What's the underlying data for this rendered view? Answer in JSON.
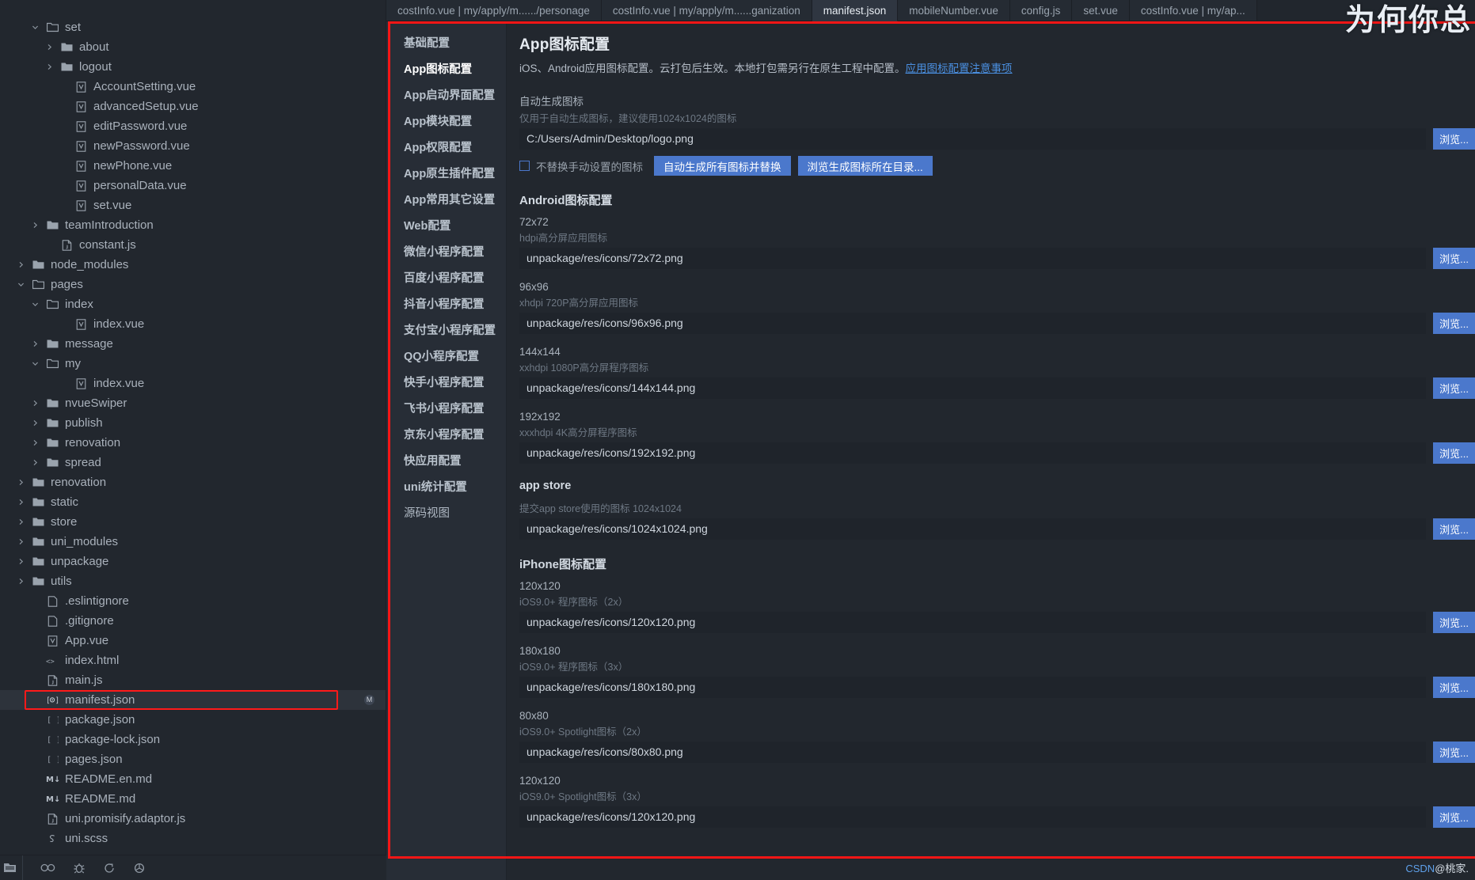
{
  "window": {
    "theme_bg": "#22272e",
    "accent": "#4b78cc",
    "highlight_outline": "#f51616"
  },
  "explorer": {
    "tree": [
      {
        "label": "set",
        "indent": 1,
        "type": "folder-open",
        "chev": "down",
        "icon": "folder-open-icon"
      },
      {
        "label": "about",
        "indent": 2,
        "type": "folder",
        "chev": "right",
        "icon": "folder-icon"
      },
      {
        "label": "logout",
        "indent": 2,
        "type": "folder",
        "chev": "right",
        "icon": "folder-icon"
      },
      {
        "label": "AccountSetting.vue",
        "indent": 3,
        "type": "vue",
        "chev": "none",
        "icon": "vue-file-icon"
      },
      {
        "label": "advancedSetup.vue",
        "indent": 3,
        "type": "vue",
        "chev": "none",
        "icon": "vue-file-icon"
      },
      {
        "label": "editPassword.vue",
        "indent": 3,
        "type": "vue",
        "chev": "none",
        "icon": "vue-file-icon"
      },
      {
        "label": "newPassword.vue",
        "indent": 3,
        "type": "vue",
        "chev": "none",
        "icon": "vue-file-icon"
      },
      {
        "label": "newPhone.vue",
        "indent": 3,
        "type": "vue",
        "chev": "none",
        "icon": "vue-file-icon"
      },
      {
        "label": "personalData.vue",
        "indent": 3,
        "type": "vue",
        "chev": "none",
        "icon": "vue-file-icon"
      },
      {
        "label": "set.vue",
        "indent": 3,
        "type": "vue",
        "chev": "none",
        "icon": "vue-file-icon"
      },
      {
        "label": "teamIntroduction",
        "indent": 1,
        "type": "folder",
        "chev": "right",
        "icon": "folder-icon"
      },
      {
        "label": "constant.js",
        "indent": 2,
        "type": "js",
        "chev": "none",
        "icon": "js-file-icon"
      },
      {
        "label": "node_modules",
        "indent": 0,
        "type": "folder",
        "chev": "right",
        "icon": "folder-icon"
      },
      {
        "label": "pages",
        "indent": 0,
        "type": "folder-open",
        "chev": "down",
        "icon": "folder-open-icon"
      },
      {
        "label": "index",
        "indent": 1,
        "type": "folder-open",
        "chev": "down",
        "icon": "folder-open-icon"
      },
      {
        "label": "index.vue",
        "indent": 3,
        "type": "vue",
        "chev": "none",
        "icon": "vue-file-icon"
      },
      {
        "label": "message",
        "indent": 1,
        "type": "folder",
        "chev": "right",
        "icon": "folder-icon"
      },
      {
        "label": "my",
        "indent": 1,
        "type": "folder-open",
        "chev": "down",
        "icon": "folder-open-icon"
      },
      {
        "label": "index.vue",
        "indent": 3,
        "type": "vue",
        "chev": "none",
        "icon": "vue-file-icon"
      },
      {
        "label": "nvueSwiper",
        "indent": 1,
        "type": "folder",
        "chev": "right",
        "icon": "folder-icon"
      },
      {
        "label": "publish",
        "indent": 1,
        "type": "folder",
        "chev": "right",
        "icon": "folder-icon"
      },
      {
        "label": "renovation",
        "indent": 1,
        "type": "folder",
        "chev": "right",
        "icon": "folder-icon"
      },
      {
        "label": "spread",
        "indent": 1,
        "type": "folder",
        "chev": "right",
        "icon": "folder-icon"
      },
      {
        "label": "renovation",
        "indent": 0,
        "type": "folder",
        "chev": "right",
        "icon": "folder-icon"
      },
      {
        "label": "static",
        "indent": 0,
        "type": "folder",
        "chev": "right",
        "icon": "folder-icon"
      },
      {
        "label": "store",
        "indent": 0,
        "type": "folder",
        "chev": "right",
        "icon": "folder-icon"
      },
      {
        "label": "uni_modules",
        "indent": 0,
        "type": "folder",
        "chev": "right",
        "icon": "folder-icon"
      },
      {
        "label": "unpackage",
        "indent": 0,
        "type": "folder",
        "chev": "right",
        "icon": "folder-icon"
      },
      {
        "label": "utils",
        "indent": 0,
        "type": "folder",
        "chev": "right",
        "icon": "folder-icon"
      },
      {
        "label": ".eslintignore",
        "indent": 1,
        "type": "plain",
        "chev": "none",
        "icon": "file-icon"
      },
      {
        "label": ".gitignore",
        "indent": 1,
        "type": "plain",
        "chev": "none",
        "icon": "file-icon"
      },
      {
        "label": "App.vue",
        "indent": 1,
        "type": "vue",
        "chev": "none",
        "icon": "vue-file-icon"
      },
      {
        "label": "index.html",
        "indent": 1,
        "type": "html",
        "chev": "none",
        "icon": "html-file-icon"
      },
      {
        "label": "main.js",
        "indent": 1,
        "type": "js",
        "chev": "none",
        "icon": "js-file-icon"
      },
      {
        "label": "manifest.json",
        "indent": 1,
        "type": "manifest",
        "chev": "none",
        "icon": "manifest-file-icon",
        "selected": true,
        "outlined": true,
        "badge": "M"
      },
      {
        "label": "package.json",
        "indent": 1,
        "type": "json",
        "chev": "none",
        "icon": "json-file-icon"
      },
      {
        "label": "package-lock.json",
        "indent": 1,
        "type": "json",
        "chev": "none",
        "icon": "json-file-icon"
      },
      {
        "label": "pages.json",
        "indent": 1,
        "type": "json",
        "chev": "none",
        "icon": "json-file-icon"
      },
      {
        "label": "README.en.md",
        "indent": 1,
        "type": "md",
        "chev": "none",
        "icon": "markdown-file-icon"
      },
      {
        "label": "README.md",
        "indent": 1,
        "type": "md",
        "chev": "none",
        "icon": "markdown-file-icon"
      },
      {
        "label": "uni.promisify.adaptor.js",
        "indent": 1,
        "type": "js",
        "chev": "none",
        "icon": "js-file-icon"
      },
      {
        "label": "uni.scss",
        "indent": 1,
        "type": "scss",
        "chev": "none",
        "icon": "scss-file-icon"
      }
    ],
    "statusbar_icons": [
      "explorer-icon",
      "search-icon",
      "debug-icon",
      "share-icon",
      "plugin-icon"
    ]
  },
  "tabs": [
    {
      "label": "costInfo.vue | my/apply/m....../personage",
      "active": false
    },
    {
      "label": "costInfo.vue | my/apply/m......ganization",
      "active": false
    },
    {
      "label": "manifest.json",
      "active": true
    },
    {
      "label": "mobileNumber.vue",
      "active": false
    },
    {
      "label": "config.js",
      "active": false
    },
    {
      "label": "set.vue",
      "active": false
    },
    {
      "label": "costInfo.vue | my/ap...",
      "active": false
    }
  ],
  "manifest_nav": [
    {
      "label": "基础配置",
      "active": false,
      "bold": true
    },
    {
      "label": "App图标配置",
      "active": true,
      "bold": true
    },
    {
      "label": "App启动界面配置",
      "active": false,
      "bold": true
    },
    {
      "label": "App模块配置",
      "active": false,
      "bold": true
    },
    {
      "label": "App权限配置",
      "active": false,
      "bold": true
    },
    {
      "label": "App原生插件配置",
      "active": false,
      "bold": true
    },
    {
      "label": "App常用其它设置",
      "active": false,
      "bold": true
    },
    {
      "label": "Web配置",
      "active": false,
      "bold": true
    },
    {
      "label": "微信小程序配置",
      "active": false,
      "bold": true
    },
    {
      "label": "百度小程序配置",
      "active": false,
      "bold": true
    },
    {
      "label": "抖音小程序配置",
      "active": false,
      "bold": true
    },
    {
      "label": "支付宝小程序配置",
      "active": false,
      "bold": true
    },
    {
      "label": "QQ小程序配置",
      "active": false,
      "bold": true
    },
    {
      "label": "快手小程序配置",
      "active": false,
      "bold": true
    },
    {
      "label": "飞书小程序配置",
      "active": false,
      "bold": true
    },
    {
      "label": "京东小程序配置",
      "active": false,
      "bold": true
    },
    {
      "label": "快应用配置",
      "active": false,
      "bold": true
    },
    {
      "label": "uni统计配置",
      "active": false,
      "bold": true
    },
    {
      "label": "源码视图",
      "active": false,
      "bold": false
    }
  ],
  "form": {
    "title": "App图标配置",
    "description_prefix": "iOS、Android应用图标配置。云打包后生效。本地打包需另行在原生工程中配置。",
    "description_link": "应用图标配置注意事项",
    "auto": {
      "label": "自动生成图标",
      "hint": "仅用于自动生成图标，建议使用1024x1024的图标",
      "value": "C:/Users/Admin/Desktop/logo.png",
      "browse_label": "浏览...",
      "checkbox_label": "不替换手动设置的图标",
      "checkbox_checked": false,
      "generate_label": "自动生成所有图标并替换",
      "open_dir_label": "浏览生成图标所在目录..."
    },
    "sections": [
      {
        "title": "Android图标配置",
        "fields": [
          {
            "label": "72x72",
            "hint": "hdpi高分屏应用图标",
            "value": "unpackage/res/icons/72x72.png",
            "browse_label": "浏览..."
          },
          {
            "label": "96x96",
            "hint": "xhdpi 720P高分屏应用图标",
            "value": "unpackage/res/icons/96x96.png",
            "browse_label": "浏览..."
          },
          {
            "label": "144x144",
            "hint": "xxhdpi 1080P高分屏程序图标",
            "value": "unpackage/res/icons/144x144.png",
            "browse_label": "浏览..."
          },
          {
            "label": "192x192",
            "hint": "xxxhdpi 4K高分屏程序图标",
            "value": "unpackage/res/icons/192x192.png",
            "browse_label": "浏览..."
          }
        ]
      },
      {
        "title": "app store",
        "latin": true,
        "fields": [
          {
            "label": "",
            "hint": "提交app store使用的图标 1024x1024",
            "value": "unpackage/res/icons/1024x1024.png",
            "browse_label": "浏览..."
          }
        ]
      },
      {
        "title": "iPhone图标配置",
        "fields": [
          {
            "label": "120x120",
            "hint": "iOS9.0+ 程序图标（2x）",
            "value": "unpackage/res/icons/120x120.png",
            "browse_label": "浏览..."
          },
          {
            "label": "180x180",
            "hint": "iOS9.0+ 程序图标（3x）",
            "value": "unpackage/res/icons/180x180.png",
            "browse_label": "浏览..."
          },
          {
            "label": "80x80",
            "hint": "iOS9.0+ Spotlight图标（2x）",
            "value": "unpackage/res/icons/80x80.png",
            "browse_label": "浏览..."
          },
          {
            "label": "120x120",
            "hint": "iOS9.0+ Spotlight图标（3x）",
            "value": "unpackage/res/icons/120x120.png",
            "browse_label": "浏览..."
          }
        ]
      }
    ]
  },
  "watermarks": {
    "top_right": "为何你总",
    "bottom_right_prefix": "CSDN",
    "bottom_right_suffix": "@桃家."
  }
}
